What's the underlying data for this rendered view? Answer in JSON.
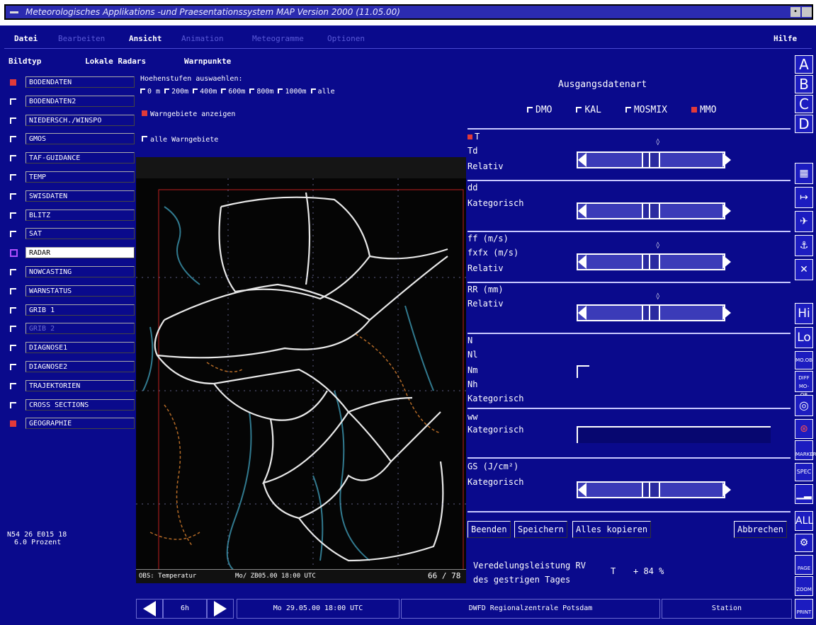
{
  "window": {
    "title": "Meteorologisches Applikations -und Praesentationssystem MAP Version 2000 (11.05.00)"
  },
  "menu": {
    "datei": "Datei",
    "bearbeiten": "Bearbeiten",
    "ansicht": "Ansicht",
    "animation": "Animation",
    "meteogramme": "Meteogramme",
    "optionen": "Optionen",
    "hilfe": "Hilfe"
  },
  "toolbar": {
    "bildtyp": "Bildtyp",
    "lokale_radars": "Lokale Radars",
    "warnpunkte": "Warnpunkte"
  },
  "layers": [
    {
      "label": "BODENDATEN",
      "checked": true
    },
    {
      "label": "BODENDATEN2",
      "checked": false
    },
    {
      "label": "NIEDERSCH./WINSPO",
      "checked": false
    },
    {
      "label": "GMOS",
      "checked": false
    },
    {
      "label": "TAF-GUIDANCE",
      "checked": false
    },
    {
      "label": "TEMP",
      "checked": false
    },
    {
      "label": "SWISDATEN",
      "checked": false
    },
    {
      "label": "BLITZ",
      "checked": false
    },
    {
      "label": "SAT",
      "checked": false
    },
    {
      "label": "RADAR",
      "checked": false
    },
    {
      "label": "NOWCASTING",
      "checked": false
    },
    {
      "label": "WARNSTATUS",
      "checked": false
    },
    {
      "label": "GRIB 1",
      "checked": false
    },
    {
      "label": "GRIB 2",
      "checked": false
    },
    {
      "label": "DIAGNOSE1",
      "checked": false
    },
    {
      "label": "DIAGNOSE2",
      "checked": false
    },
    {
      "label": "TRAJEKTORIEN",
      "checked": false
    },
    {
      "label": "CROSS SECTIONS",
      "checked": false
    },
    {
      "label": "GEOGRAPHIE",
      "checked": true
    }
  ],
  "coords": {
    "line1": "N54 26 E015 18",
    "line2": "6.0 Prozent"
  },
  "heights": {
    "title": "Hoehenstufen auswaehlen:",
    "options": [
      "0 m",
      "200m",
      "400m",
      "600m",
      "800m",
      "1000m",
      "alle"
    ],
    "warngebiete": "Warngebiete anzeigen",
    "alle_warngebiete": "alle Warngebiete"
  },
  "map": {
    "footer_left": "OBS: Temperatur",
    "footer_mid": "Mo/ ZB05.00 18:00 UTC",
    "footer_right": "66 / 78"
  },
  "panel": {
    "title": "Ausgangsdatenart",
    "sources": [
      {
        "label": "DMO",
        "checked": false
      },
      {
        "label": "KAL",
        "checked": false
      },
      {
        "label": "MOSMIX",
        "checked": false
      },
      {
        "label": "MMO",
        "checked": true
      }
    ],
    "t": "T",
    "td": "Td",
    "relativ1": "Relativ",
    "dd": "dd",
    "kategorisch1": "Kategorisch",
    "ff": "ff (m/s)",
    "fxfx": "fxfx (m/s)",
    "relativ2": "Relativ",
    "rr": "RR (mm)",
    "relativ3": "Relativ",
    "n": "N",
    "nl": "Nl",
    "nm": "Nm",
    "nh": "Nh",
    "kategorisch2": "Kategorisch",
    "ww": "ww",
    "kategorisch3": "Kategorisch",
    "gs": "GS (J/cm²)",
    "kategorisch4": "Kategorisch",
    "beenden": "Beenden",
    "speichern": "Speichern",
    "kopieren": "Alles kopieren",
    "abbrechen": "Abbrechen",
    "veredelung1": "Veredelungsleistung RV",
    "veredelung2": "des gestrigen Tages",
    "veredelung_t": "T",
    "veredelung_val": "+ 84 %"
  },
  "righttools": {
    "a": "A",
    "b": "B",
    "c": "C",
    "d": "D",
    "hi": "Hi",
    "lo": "Lo",
    "mo": "MO.OB",
    "diff": "DIFF MO-OB",
    "marker": "MARKER",
    "spec": "SPEC",
    "all": "ALL",
    "page": "PAGE",
    "zoom": "ZOOM",
    "print": "PRINT"
  },
  "status": {
    "step": "6h",
    "time": "Mo 29.05.00 18:00 UTC",
    "center": "DWFD Regionalzentrale Potsdam",
    "station": "Station"
  }
}
